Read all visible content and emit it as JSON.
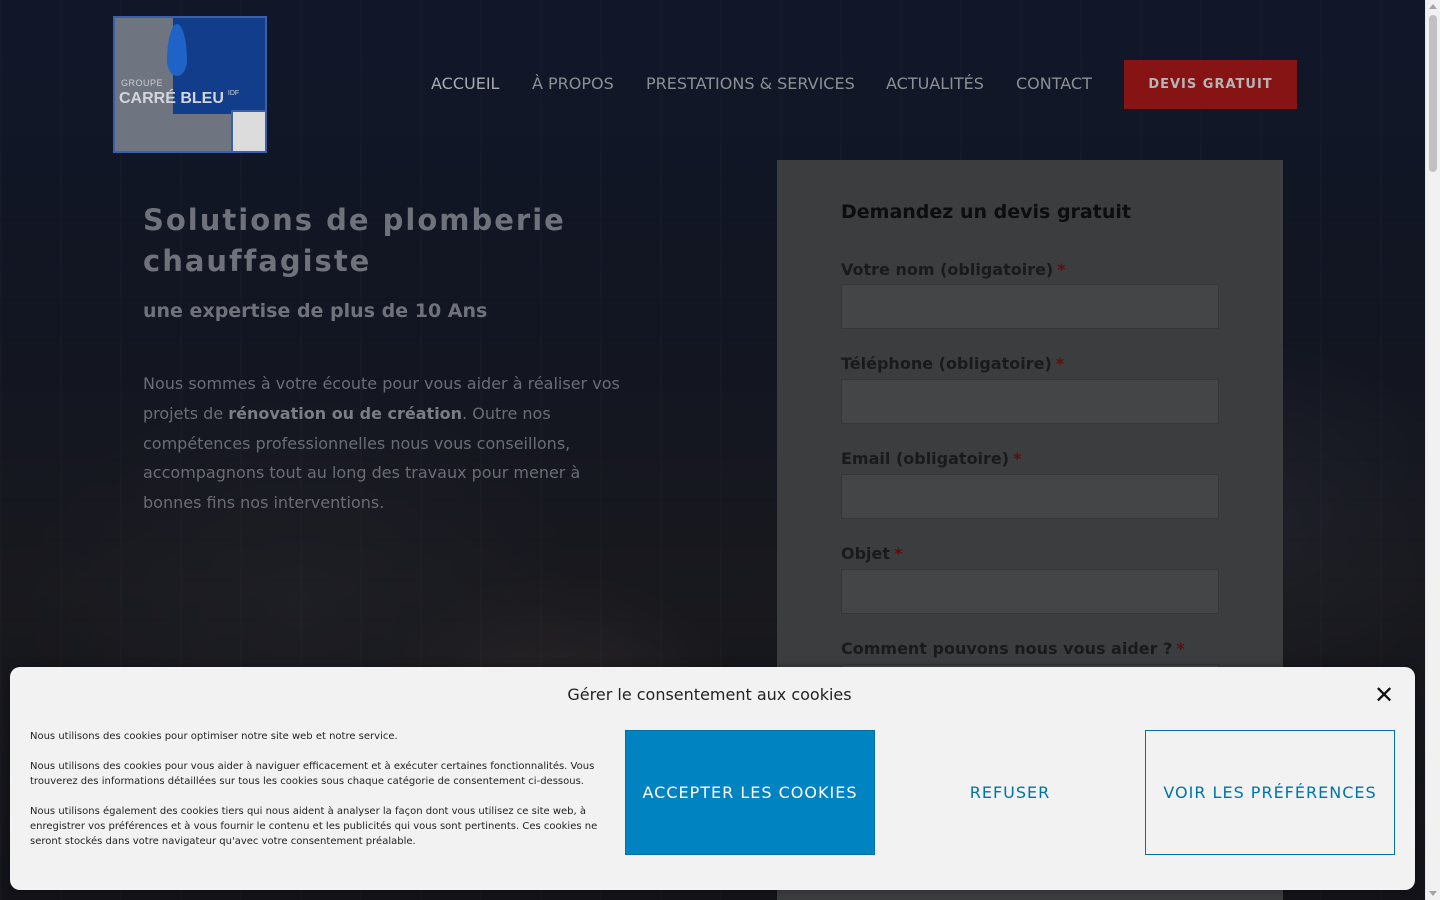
{
  "header": {
    "logo": {
      "line1": "GROUPE",
      "line2": "CARRÉ BLEU",
      "suffix": "IDF"
    },
    "nav": [
      {
        "label": "ACCUEIL"
      },
      {
        "label": "À PROPOS"
      },
      {
        "label": "PRESTATIONS & SERVICES"
      },
      {
        "label": "ACTUALITÉS"
      },
      {
        "label": "CONTACT"
      }
    ],
    "cta_label": "DEVIS GRATUIT"
  },
  "hero": {
    "title": "Solutions de plomberie chauffagiste",
    "subtitle": "une expertise de plus de 10 Ans",
    "text_before": "Nous sommes à votre écoute pour vous aider à réaliser vos projets de ",
    "text_bold": "rénovation ou de création",
    "text_after": ". Outre nos compétences professionnelles nous vous conseillons, accompagnons tout au long des travaux pour mener à bonnes fins nos interventions."
  },
  "form": {
    "title": "Demandez un devis gratuit",
    "required_mark": "*",
    "fields": [
      {
        "label": "Votre nom (obligatoire)"
      },
      {
        "label": "Téléphone (obligatoire)"
      },
      {
        "label": "Email (obligatoire)"
      },
      {
        "label": "Objet"
      },
      {
        "label": "Comment pouvons nous vous aider ?"
      }
    ]
  },
  "cookie": {
    "title": "Gérer le consentement aux cookies",
    "paragraphs": [
      "Nous utilisons des cookies pour optimiser notre site web et notre service.",
      "Nous utilisons des cookies pour vous aider à naviguer efficacement et à exécuter certaines fonctionnalités. Vous trouverez des informations détaillées sur tous les cookies sous chaque catégorie de consentement ci-dessous.",
      "Nous utilisons également des cookies tiers qui nous aident à analyser la façon dont vous utilisez ce site web, à enregistrer vos préférences et à vous fournir le contenu et les publicités qui vous sont pertinents. Ces cookies ne seront stockés dans votre navigateur qu'avec votre consentement préalable."
    ],
    "accept_label": "ACCEPTER LES COOKIES",
    "refuse_label": "REFUSER",
    "prefs_label": "VOIR LES PRÉFÉRENCES",
    "close_icon": "close-icon"
  },
  "colors": {
    "accent_blue": "#0083c1",
    "cta_red": "#861414",
    "required_red": "#5b1010"
  }
}
